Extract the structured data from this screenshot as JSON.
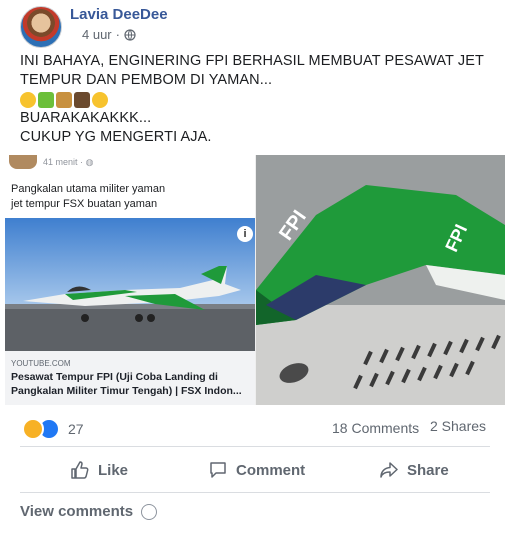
{
  "post": {
    "author": "Lavia DeeDee",
    "time": "4 uur",
    "separator": "·",
    "privacy_icon": "globe-icon",
    "lines": [
      "INI BAHAYA, ENGINERING FPI BERHASIL MEMBUAT PESAWAT JET",
      "TEMPUR DAN PEMBOM DI YAMAN..."
    ],
    "emojis": [
      "laughing-emoji",
      "lizard-emoji",
      "camel-emoji",
      "eagle-emoji",
      "laughing-emoji"
    ],
    "line3": "BUARAKAKAKKK...",
    "line4": "CUKUP YG MENGERTI AJA."
  },
  "shared": {
    "time": "41 menit",
    "separator": "·",
    "text_line1": "Pangkalan utama militer yaman",
    "text_line2": "jet tempur FSX buatan yaman",
    "info": "i",
    "domain": "YOUTUBE.COM",
    "title": "Pesawat Tempur FPI (Uji Coba Landing di Pangkalan Militer Timur Tengah) | FSX Indon..."
  },
  "photo": {
    "label_left": "FPI",
    "label_right": "FPI"
  },
  "stats": {
    "reactions": [
      "haha",
      "like"
    ],
    "reaction_count": "27",
    "comments": "18 Comments",
    "shares": "2 Shares"
  },
  "actions": {
    "like": "Like",
    "comment": "Comment",
    "share": "Share"
  },
  "view_comments": "View comments",
  "colors": {
    "author_link": "#385898",
    "secondary_text": "#606770",
    "like_blue": "#2078f4",
    "haha_yellow": "#f7b125",
    "jet_green": "#1f9a3a"
  }
}
